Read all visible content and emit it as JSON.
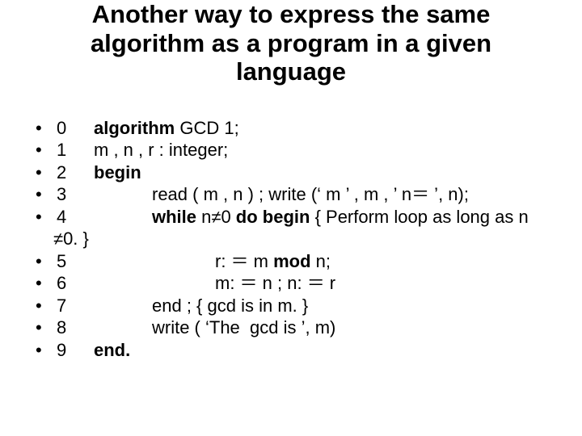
{
  "title": "Another way to express the same algorithm as a program in a given language",
  "bullet": "•",
  "lines": {
    "l0_num": "0",
    "l0_a": "algorithm",
    "l0_b": " GCD 1;",
    "l1_num": "1",
    "l1_a": "m , n , r : integer;",
    "l2_num": "2",
    "l2_a": "begin",
    "l3_num": "3",
    "l3_a": "read ( m , n ) ; write (‘ m ’ , m , ’ n＝ ’, n);",
    "l4_num": "4",
    "l4_a": "while",
    "l4_b": " n≠0 ",
    "l4_c": "do begin",
    "l4_d": " { Perform loop as long as n",
    "l4_cont": "≠0. }",
    "l5_num": "5",
    "l5_a": "r: ＝ m ",
    "l5_b": "mod",
    "l5_c": " n;",
    "l6_num": "6",
    "l6_a": "m: ＝ n ; n: ＝ r",
    "l7_num": "7",
    "l7_a": "end ; { gcd is in m. }",
    "l8_num": "8",
    "l8_a": "write ( ‘The  gcd is ’, m)",
    "l9_num": "9",
    "l9_a": "end."
  }
}
